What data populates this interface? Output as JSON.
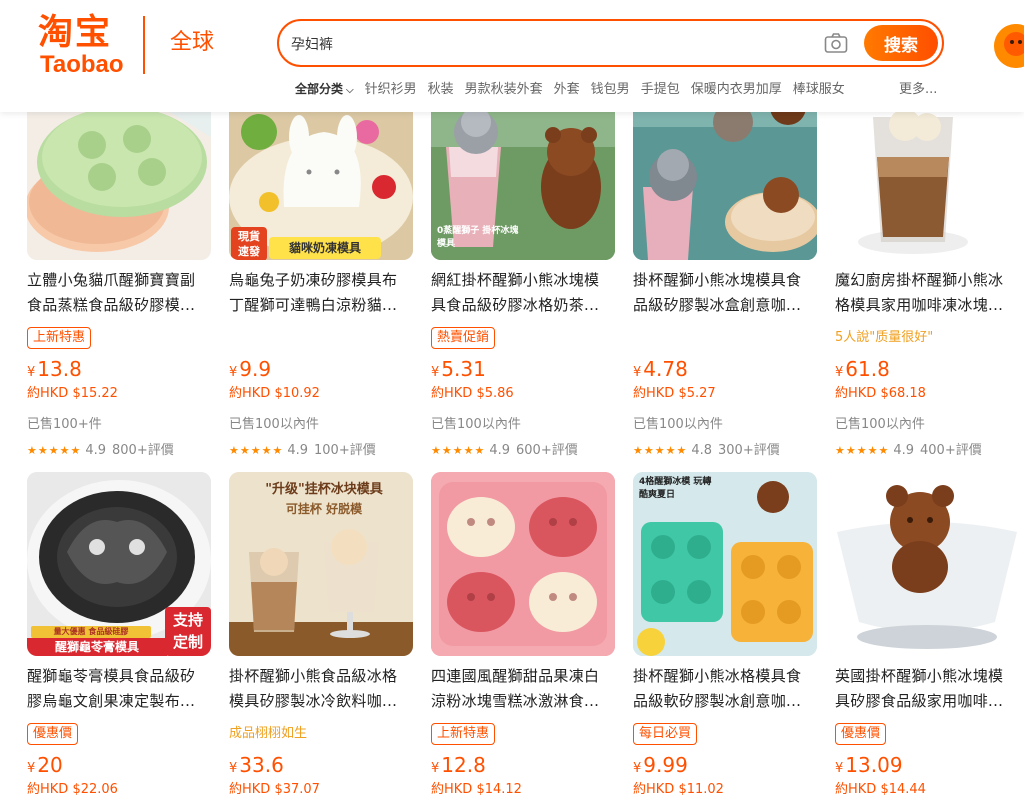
{
  "header": {
    "logo_cn": "淘宝",
    "logo_en": "Taobao",
    "site_name": "全球",
    "search_value": "孕妇裤",
    "search_button": "搜索",
    "nav": [
      "全部分类",
      "针织衫男",
      "秋装",
      "男款秋装外套",
      "外套",
      "钱包男",
      "手提包",
      "保暖内衣男加厚",
      "棒球服女"
    ],
    "nav_more": "更多..."
  },
  "row1": [
    {
      "title_line1": "立體小兔貓爪醒獅寶寶副",
      "title_line2": "食品蒸糕食品級矽膠模...",
      "badge": "上新特惠",
      "price_currency": "¥",
      "price": "13.8",
      "hkd": "約HKD $15.22",
      "sold": "已售100+件",
      "score": "4.9",
      "reviews": "800+評價"
    },
    {
      "title_line1": "烏龜兔子奶凍矽膠模具布",
      "title_line2": "丁醒獅可達鴨白涼粉貓...",
      "thumb_tag1": "現貨速發",
      "thumb_tag2": "貓咪奶凍模具",
      "price_currency": "¥",
      "price": "9.9",
      "hkd": "約HKD $10.92",
      "sold": "已售100以內件",
      "score": "4.9",
      "reviews": "100+評價"
    },
    {
      "title_line1": "網紅掛杯醒獅小熊冰塊模",
      "title_line2": "具食品級矽膠冰格奶茶...",
      "thumb_tag": "0蒸醒獅子 掛杯冰塊模具",
      "badge": "熱賣促銷",
      "price_currency": "¥",
      "price": "5.31",
      "hkd": "約HKD $5.86",
      "sold": "已售100以內件",
      "score": "4.9",
      "reviews": "600+評價"
    },
    {
      "title_line1": "掛杯醒獅小熊冰塊模具食",
      "title_line2": "品級矽膠製冰盒創意咖...",
      "price_currency": "¥",
      "price": "4.78",
      "hkd": "約HKD $5.27",
      "sold": "已售100以內件",
      "score": "4.8",
      "reviews": "300+評價"
    },
    {
      "title_line1": "魔幻廚房掛杯醒獅小熊冰",
      "title_line2": "格模具家用咖啡凍冰塊...",
      "note": "5人說\"质量很好\"",
      "price_currency": "¥",
      "price": "61.8",
      "hkd": "約HKD $68.18",
      "sold": "已售100以內件",
      "score": "4.9",
      "reviews": "400+評價"
    }
  ],
  "row2": [
    {
      "title_line1": "醒獅龜苓膏模具食品級矽",
      "title_line2": "膠烏龜文創果凍定製布...",
      "thumb_tag1": "量大優惠 食品級硅膠",
      "thumb_tag2": "醒獅龜苓膏模具",
      "thumb_tag3": "支持定制",
      "badge": "優惠價",
      "price_currency": "¥",
      "price": "20",
      "hkd": "約HKD $22.06"
    },
    {
      "title_line1": "掛杯醒獅小熊食品級冰格",
      "title_line2": "模具矽膠製冰冷飲料咖...",
      "thumb_tag1": "\"升级\"挂杯冰块模具",
      "thumb_tag2": "可挂杯 好脱模",
      "note": "成品栩栩如生",
      "price_currency": "¥",
      "price": "33.6",
      "hkd": "約HKD $37.07"
    },
    {
      "title_line1": "四連國風醒獅甜品果凍白",
      "title_line2": "涼粉冰塊雪糕冰激淋食...",
      "badge": "上新特惠",
      "price_currency": "¥",
      "price": "12.8",
      "hkd": "約HKD $14.12"
    },
    {
      "title_line1": "掛杯醒獅小熊冰格模具食",
      "title_line2": "品級軟矽膠製冰創意咖...",
      "thumb_tag": "4格醒獅冰模 玩轉酷爽夏日",
      "badge": "每日必買",
      "price_currency": "¥",
      "price": "9.99",
      "hkd": "約HKD $11.02"
    },
    {
      "title_line1": "英國掛杯醒獅小熊冰塊模",
      "title_line2": "具矽膠食品級家用咖啡...",
      "badge": "優惠價",
      "price_currency": "¥",
      "price": "13.09",
      "hkd": "約HKD $14.44"
    }
  ],
  "colors": {
    "accent": "#ff5000",
    "note": "#f0a020",
    "muted": "#888888"
  },
  "icons": [
    "camera-icon",
    "star-icon",
    "chevron-down-icon",
    "avatar"
  ]
}
